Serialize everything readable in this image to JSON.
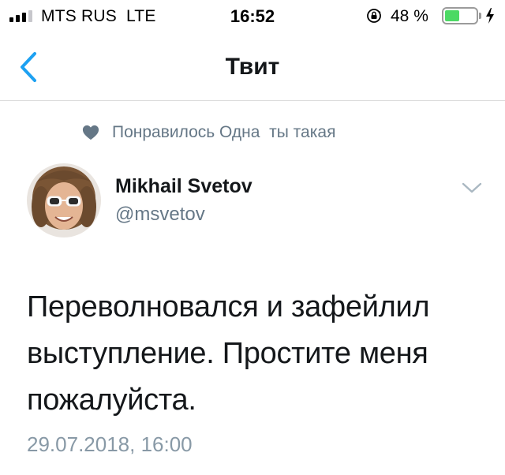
{
  "status_bar": {
    "carrier": "MTS RUS",
    "network": "LTE",
    "time": "16:52",
    "battery_percent": "48 %",
    "battery_level": 0.48,
    "signal_bars": 3,
    "signal_bars_total": 4,
    "icons": [
      "orientation-lock-icon",
      "battery-icon",
      "charging-bolt-icon"
    ]
  },
  "nav": {
    "title": "Твит",
    "back_icon": "chevron-left-icon"
  },
  "social_context": {
    "icon": "heart-icon",
    "text": "Понравилось Одна  ты такая"
  },
  "author": {
    "name": "Mikhail Svetov",
    "handle": "@msvetov",
    "menu_icon": "chevron-down-icon"
  },
  "tweet": {
    "lines": [
      "Переволновался и зафейлил",
      "выступление. Простите меня",
      "пожалуйста."
    ],
    "timestamp": "29.07.2018, 16:00"
  },
  "colors": {
    "accent": "#1da1f2",
    "secondary_text": "#657786",
    "battery_fill": "#4cd964"
  }
}
